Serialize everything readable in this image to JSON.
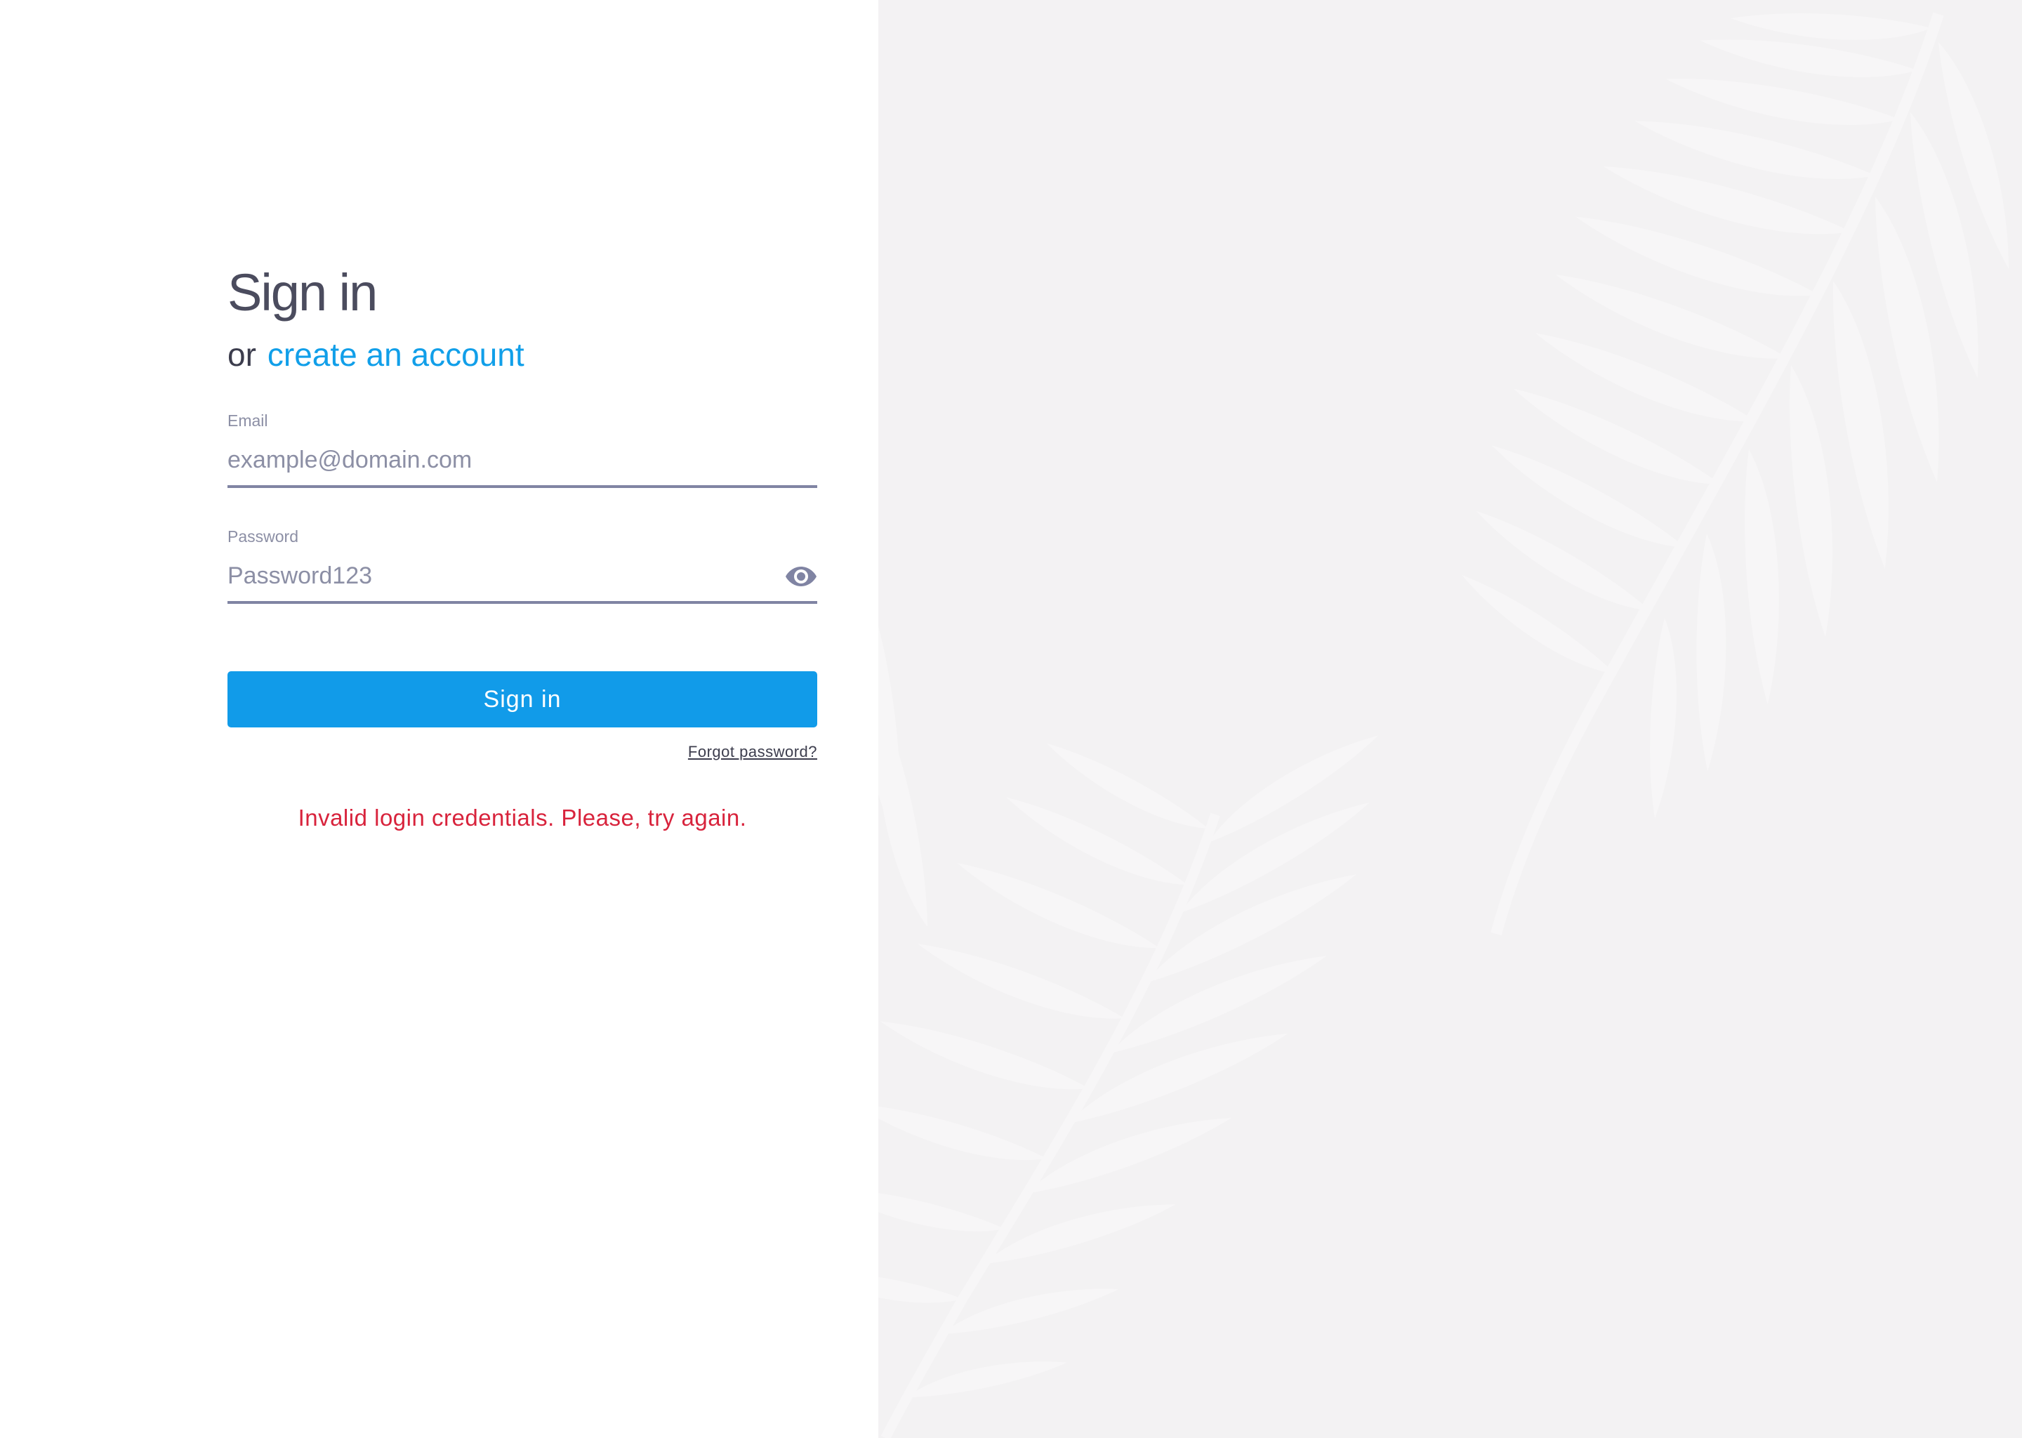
{
  "signin": {
    "title": "Sign in",
    "or_text": "or",
    "create_account_link": "create an account"
  },
  "email": {
    "label": "Email",
    "placeholder": "example@domain.com",
    "value": ""
  },
  "password": {
    "label": "Password",
    "placeholder": "Password123",
    "value": ""
  },
  "icons": {
    "password_toggle": "eye-icon"
  },
  "actions": {
    "signin_button": "Sign in",
    "forgot_password": "Forgot password?"
  },
  "error_message": "Invalid login credentials. Please, try again.",
  "colors": {
    "accent": "#119be9",
    "error": "#d8233c",
    "right_panel_bg": "#f3f2f3"
  }
}
